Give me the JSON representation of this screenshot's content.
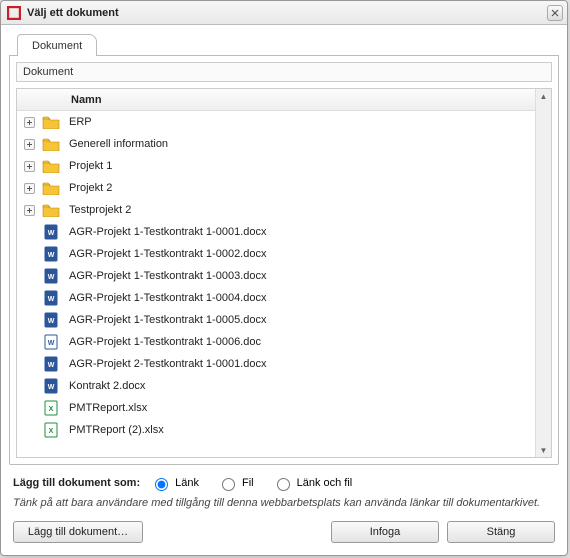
{
  "window": {
    "title": "Välj ett dokument",
    "close_icon": "close-icon"
  },
  "tabs": [
    {
      "label": "Dokument"
    }
  ],
  "panel": {
    "title": "Dokument",
    "column_header": "Namn"
  },
  "tree": [
    {
      "type": "folder",
      "name": "ERP"
    },
    {
      "type": "folder",
      "name": "Generell information"
    },
    {
      "type": "folder",
      "name": "Projekt 1"
    },
    {
      "type": "folder",
      "name": "Projekt 2"
    },
    {
      "type": "folder",
      "name": "Testprojekt 2"
    },
    {
      "type": "docx",
      "name": "AGR-Projekt 1-Testkontrakt 1-0001.docx"
    },
    {
      "type": "docx",
      "name": "AGR-Projekt 1-Testkontrakt 1-0002.docx"
    },
    {
      "type": "docx",
      "name": "AGR-Projekt 1-Testkontrakt 1-0003.docx"
    },
    {
      "type": "docx",
      "name": "AGR-Projekt 1-Testkontrakt 1-0004.docx"
    },
    {
      "type": "docx",
      "name": "AGR-Projekt 1-Testkontrakt 1-0005.docx"
    },
    {
      "type": "doc",
      "name": "AGR-Projekt 1-Testkontrakt 1-0006.doc"
    },
    {
      "type": "docx",
      "name": "AGR-Projekt 2-Testkontrakt 1-0001.docx"
    },
    {
      "type": "docx",
      "name": "Kontrakt 2.docx"
    },
    {
      "type": "xlsx",
      "name": "PMTReport.xlsx"
    },
    {
      "type": "xlsx",
      "name": "PMTReport (2).xlsx"
    }
  ],
  "add_as": {
    "prompt": "Lägg till dokument som:",
    "options": [
      {
        "label": "Länk",
        "checked": true
      },
      {
        "label": "Fil",
        "checked": false
      },
      {
        "label": "Länk och fil",
        "checked": false
      }
    ]
  },
  "hint": "Tänk på att bara användare med tillgång till denna webbarbetsplats kan använda länkar till dokumentarkivet.",
  "buttons": {
    "add_document": "Lägg till dokument…",
    "insert": "Infoga",
    "close": "Stäng"
  },
  "icons": {
    "folder_color": "#f6c437",
    "docx_color": "#2b579a",
    "doc_border": "#2b579a",
    "xlsx_color": "#1d8f3e",
    "logo_color": "#c62128"
  }
}
